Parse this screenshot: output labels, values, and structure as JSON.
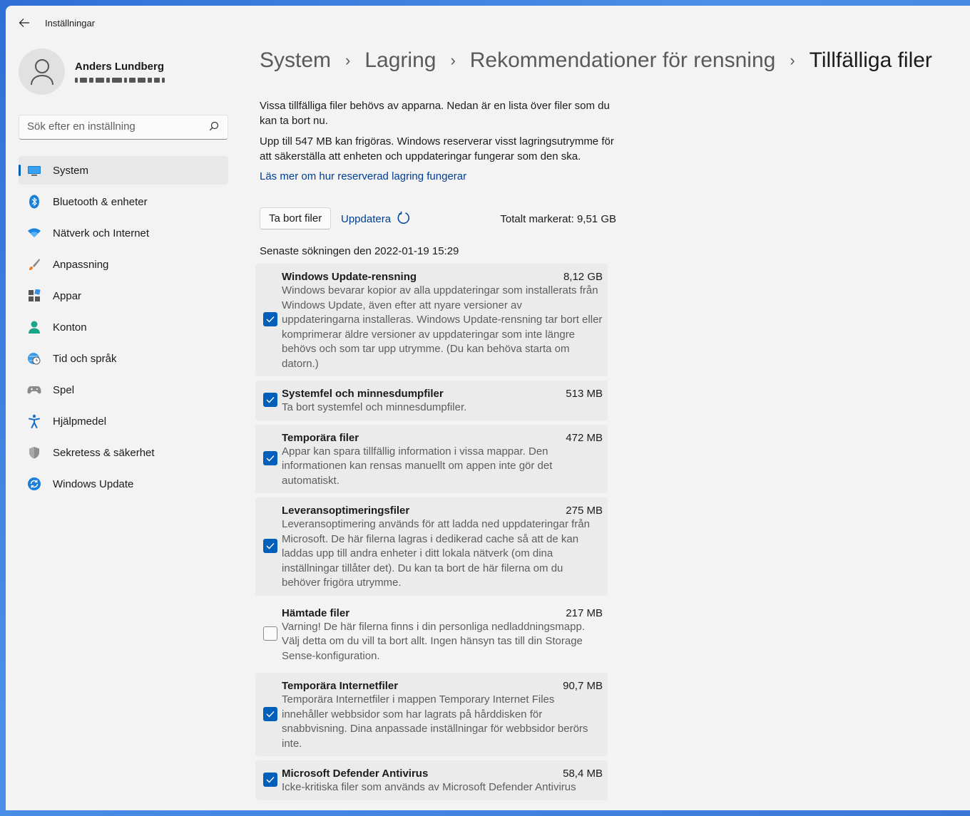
{
  "window": {
    "title": "Inställningar"
  },
  "profile": {
    "name": "Anders Lundberg"
  },
  "search": {
    "placeholder": "Sök efter en inställning"
  },
  "sidebar": {
    "items": [
      {
        "label": "System",
        "icon": "display-icon",
        "active": true
      },
      {
        "label": "Bluetooth & enheter",
        "icon": "bluetooth-icon"
      },
      {
        "label": "Nätverk och Internet",
        "icon": "wifi-icon"
      },
      {
        "label": "Anpassning",
        "icon": "brush-icon"
      },
      {
        "label": "Appar",
        "icon": "apps-icon"
      },
      {
        "label": "Konton",
        "icon": "person-icon"
      },
      {
        "label": "Tid och språk",
        "icon": "globe-clock-icon"
      },
      {
        "label": "Spel",
        "icon": "gamepad-icon"
      },
      {
        "label": "Hjälpmedel",
        "icon": "accessibility-icon"
      },
      {
        "label": "Sekretess & säkerhet",
        "icon": "shield-icon"
      },
      {
        "label": "Windows Update",
        "icon": "update-icon"
      }
    ]
  },
  "breadcrumb": {
    "items": [
      "System",
      "Lagring",
      "Rekommendationer för rensning",
      "Tillfälliga filer"
    ]
  },
  "main": {
    "description1": "Vissa tillfälliga filer behövs av apparna. Nedan är en lista över filer som du kan ta bort nu.",
    "description2": "Upp till 547 MB kan frigöras. Windows reserverar visst lagringsutrymme för att säkerställa att enheten och uppdateringar fungerar som den ska.",
    "learn_more": "Läs mer om hur reserverad lagring fungerar",
    "remove_button": "Ta bort filer",
    "refresh_button": "Uppdatera",
    "total_selected": "Totalt markerat: 9,51 GB",
    "last_scan": "Senaste sökningen den 2022-01-19 15:29"
  },
  "files": [
    {
      "name": "Windows Update-rensning",
      "size": "8,12 GB",
      "checked": true,
      "desc": "Windows bevarar kopior av alla uppdateringar som installerats från Windows Update, även efter att nyare versioner av uppdateringarna installeras. Windows Update-rensning tar bort eller komprimerar äldre versioner av uppdateringar som inte längre behövs och som tar upp utrymme. (Du kan behöva starta om datorn.)"
    },
    {
      "name": "Systemfel och minnesdumpfiler",
      "size": "513 MB",
      "checked": true,
      "desc": "Ta bort systemfel och minnesdumpfiler."
    },
    {
      "name": "Temporära filer",
      "size": "472 MB",
      "checked": true,
      "desc": "Appar kan spara tillfällig information i vissa mappar. Den informationen kan rensas manuellt om appen inte gör det automatiskt."
    },
    {
      "name": "Leveransoptimeringsfiler",
      "size": "275 MB",
      "checked": true,
      "desc": "Leveransoptimering används för att ladda ned uppdateringar från Microsoft. De här filerna lagras i dedikerad cache så att de kan laddas upp till andra enheter i ditt lokala nätverk (om dina inställningar tillåter det). Du kan ta bort de här filerna om du behöver frigöra utrymme."
    },
    {
      "name": "Hämtade filer",
      "size": "217 MB",
      "checked": false,
      "desc": "Varning! De här filerna finns i din personliga nedladdningsmapp. Välj detta om du vill ta bort allt. Ingen hänsyn tas till din Storage Sense-konfiguration."
    },
    {
      "name": "Temporära Internetfiler",
      "size": "90,7 MB",
      "checked": true,
      "desc": "Temporära Internetfiler i mappen Temporary Internet Files innehåller webbsidor som har lagrats på hårddisken för snabbvisning. Dina anpassade inställningar för webbsidor berörs inte."
    },
    {
      "name": "Microsoft Defender Antivirus",
      "size": "58,4 MB",
      "checked": true,
      "desc": "Icke-kritiska filer som används av Microsoft Defender Antivirus"
    }
  ],
  "colors": {
    "accent": "#005fb8",
    "link": "#003e92",
    "background": "#f3f3f3"
  }
}
